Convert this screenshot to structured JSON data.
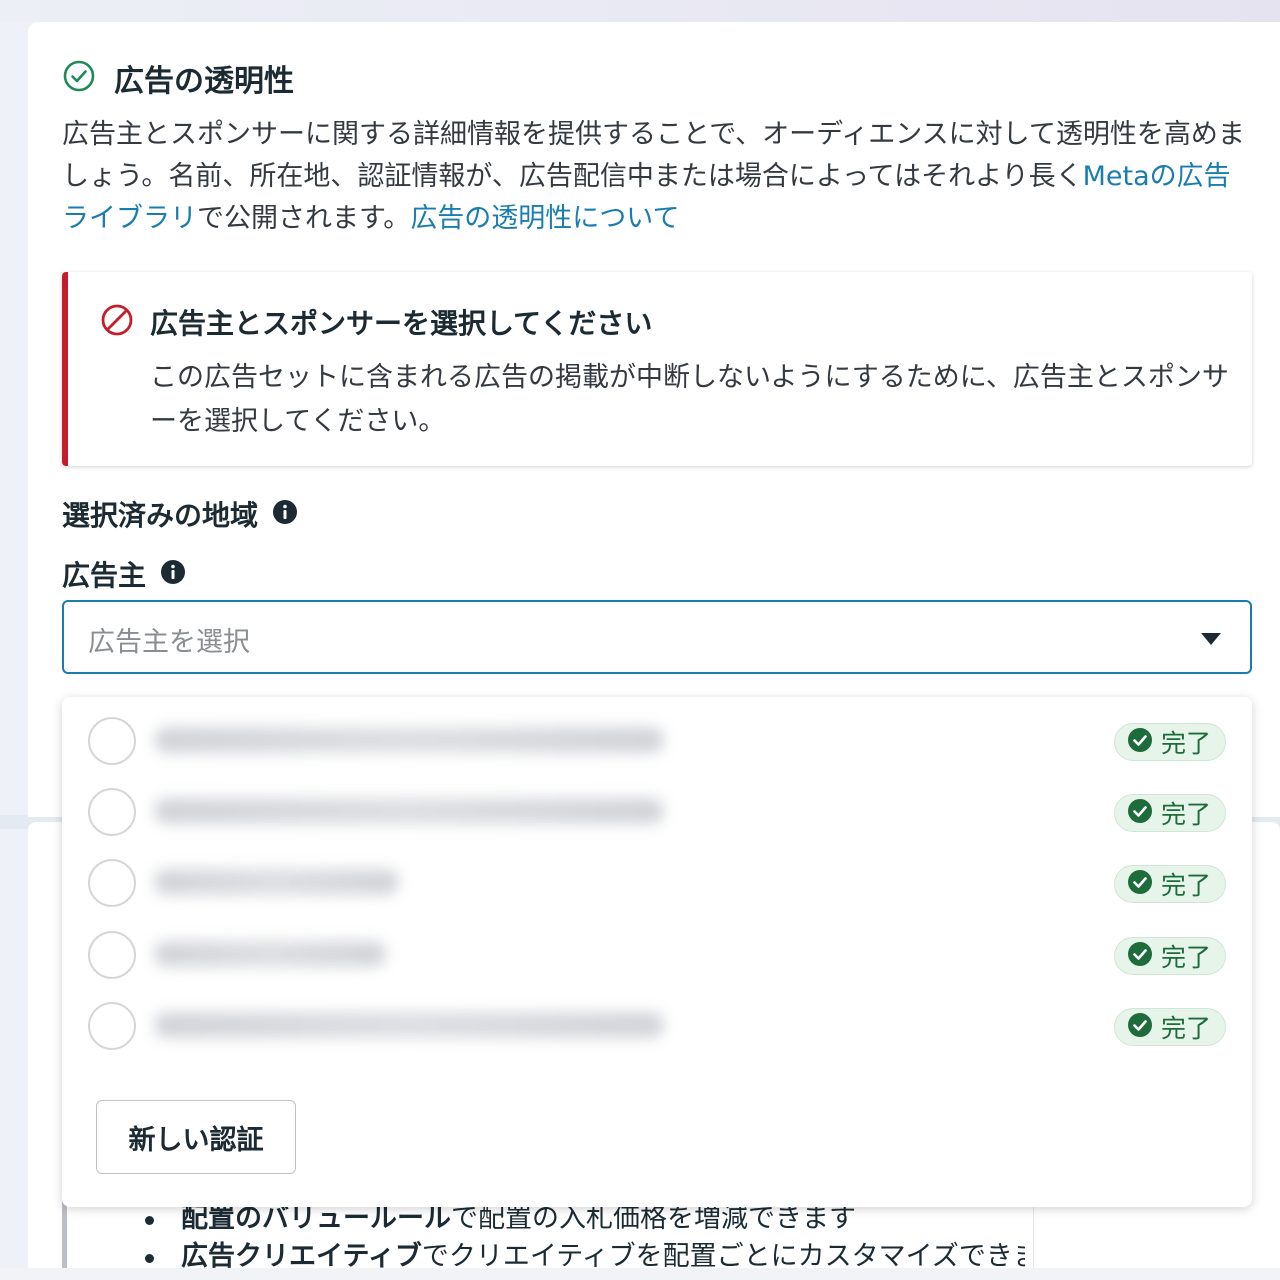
{
  "section": {
    "title": "広告の透明性",
    "desc_part1": "広告主とスポンサーに関する詳細情報を提供することで、オーディエンスに対して透明性を高めましょう。名前、所在地、認証情報が、広告配信中または場合によってはそれより長く",
    "desc_link1": "Metaの広告ライブラリ",
    "desc_part2": "で公開されます。",
    "desc_link2": "広告の透明性について"
  },
  "error": {
    "title": "広告主とスポンサーを選択してください",
    "body": "この広告セットに含まれる広告の掲載が中断しないようにするために、広告主とスポンサーを選択してください。"
  },
  "regions_label": "選択済みの地域",
  "advertiser_label": "広告主",
  "advertiser_select": {
    "placeholder": "広告主を選択"
  },
  "dropdown": {
    "options": [
      {
        "status": "完了"
      },
      {
        "status": "完了"
      },
      {
        "status": "完了"
      },
      {
        "status": "完了"
      },
      {
        "status": "完了"
      }
    ],
    "new_auth_label": "新しい認証"
  },
  "background_list": {
    "item1_em": "配置のバリュールール",
    "item1_rest": "で配置の入札価格を増減できます",
    "item2_em": "広告クリエイティブ",
    "item2_rest": "でクリエイティブを配置ごとにカスタマイズできます"
  },
  "colors": {
    "link": "#1a7db0",
    "error_accent": "#c31f2a",
    "success": "#1e6b3c",
    "success_bg": "#e6f4ea"
  },
  "icons": {
    "title": "check-circle-icon",
    "error": "prohibited-icon",
    "info": "info-icon",
    "caret": "caret-down-icon",
    "status": "check-circle-filled-icon"
  }
}
